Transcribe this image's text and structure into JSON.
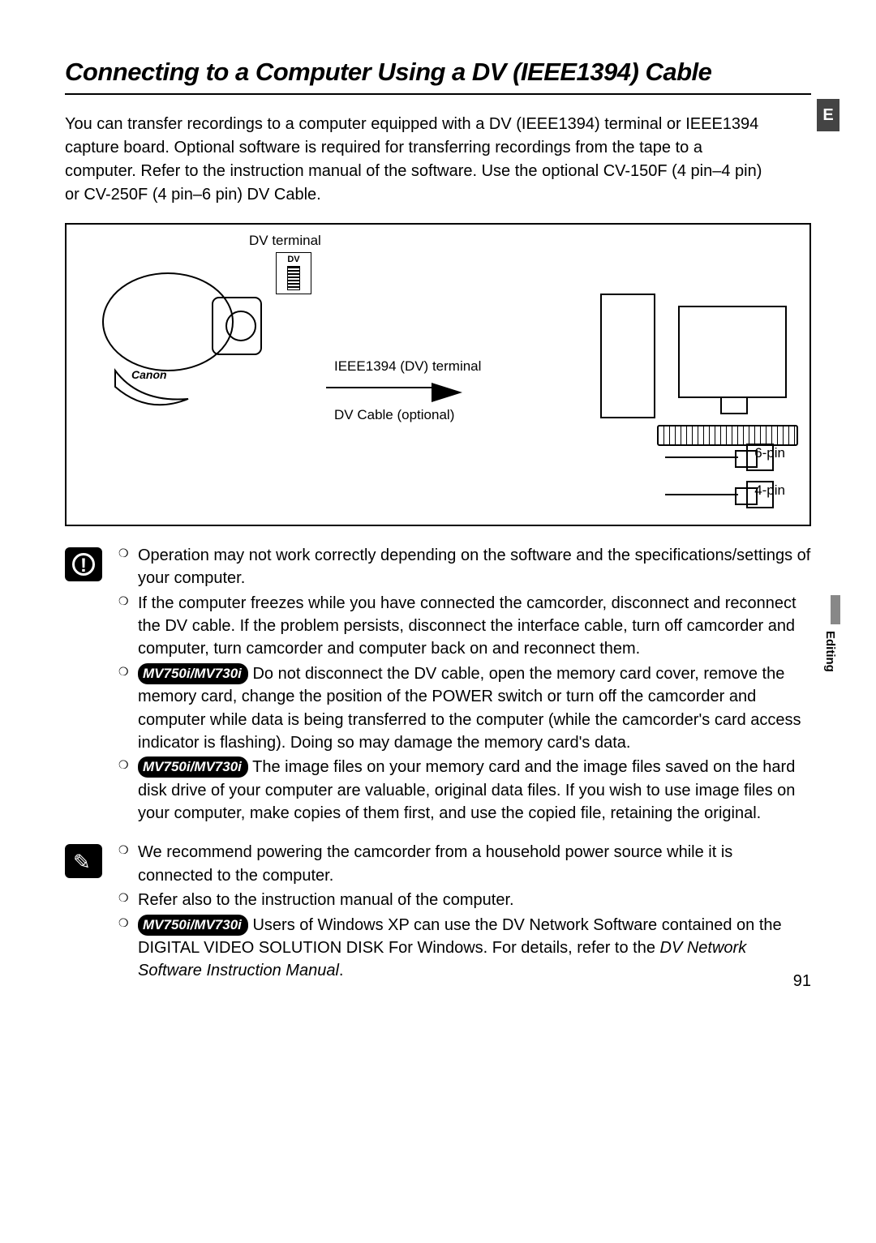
{
  "title": "Connecting to a Computer Using a DV (IEEE1394) Cable",
  "lang_tab": "E",
  "side_label": "Editing",
  "intro": "You can transfer recordings to a computer equipped with a DV (IEEE1394) terminal or IEEE1394 capture board. Optional software is required for transferring recordings from the tape to a computer. Refer to the instruction manual of the software. Use the optional CV-150F (4 pin–4 pin) or CV-250F (4 pin–6 pin) DV Cable.",
  "diagram": {
    "dv_terminal": "DV terminal",
    "dv_label": "DV",
    "ieee_terminal": "IEEE1394 (DV) terminal",
    "dv_cable": "DV Cable (optional)",
    "pin6": "6-pin",
    "pin4": "4-pin"
  },
  "model_badge": "MV750i/MV730i",
  "warnings": {
    "w1": "Operation may not work correctly depending on the software and the specifications/settings of your computer.",
    "w2": "If the computer freezes while you have connected the camcorder, disconnect and reconnect the DV cable. If the problem persists, disconnect the interface cable, turn off camcorder and computer, turn camcorder and computer back on and reconnect them.",
    "w3": " Do not disconnect the DV cable, open the memory card cover, remove the memory card, change the position of the POWER switch or turn off the camcorder and computer while data is being transferred to the computer (while the camcorder's card access indicator is flashing). Doing so may damage the memory card's data.",
    "w4": " The image files on your memory card and the image files saved on the hard disk drive of your computer are valuable, original data files. If you wish to use image files on your computer, make copies of them first, and use the copied file, retaining the original."
  },
  "notes": {
    "n1": "We recommend powering the camcorder from a household power source while it is connected to the computer.",
    "n2": "Refer also to the instruction manual of the computer.",
    "n3a": " Users of Windows XP can use the DV Network Software contained on the DIGITAL VIDEO SOLUTION DISK For Windows. For details, refer to the ",
    "n3b": "DV Network Software Instruction Manual",
    "n3c": "."
  },
  "page_number": "91"
}
